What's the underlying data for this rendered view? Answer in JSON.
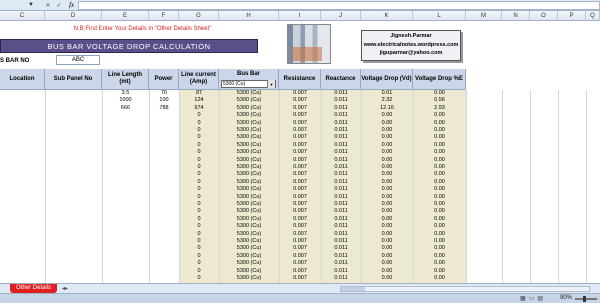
{
  "formula_bar": {
    "fx_label": "fx",
    "namebox_arrow": "▼",
    "cancel_icon": "✕",
    "enter_icon": "✓"
  },
  "columns": [
    "C",
    "D",
    "E",
    "F",
    "G",
    "H",
    "I",
    "J",
    "K",
    "L",
    "M",
    "N",
    "O",
    "P",
    "Q"
  ],
  "notice": "N.B:First Enter Your Details in \"Other Details Sheet\"",
  "title": "BUS BAR  VOLTAGE DROP  CALCULATION",
  "author": {
    "name": "Jignesh.Parmar",
    "website": "www.electricalnotes.wordpress.com",
    "email": "jiguparmar@yahoo.com"
  },
  "bus_bar_no": {
    "label": "S BAR NO",
    "value": "ABC"
  },
  "table": {
    "headers": {
      "location": "Location",
      "sub_panel": "Sub Panel No",
      "line_length": "Line Length (mt)",
      "power": "Power",
      "line_current": "Line current (Amp)",
      "bus_bar": "Bus Bar",
      "bus_bar_select": "5300 (Cu)",
      "resistance": "Resistance",
      "reactance": "Reactance",
      "vd": "Voltage Drop (Vd)",
      "vd_pct": "Voltage Drop %E"
    },
    "rows": [
      [
        "3.5",
        "70",
        "87",
        "5300 (Cu)",
        "0.007",
        "0.011",
        "0.01",
        "0.00"
      ],
      [
        "1000",
        "100",
        "124",
        "5300 (Cu)",
        "0.007",
        "0.011",
        "2.32",
        "0.56"
      ],
      [
        "666",
        "788",
        "974",
        "5300 (Cu)",
        "0.007",
        "0.011",
        "12.16",
        "2.93"
      ],
      [
        "",
        "",
        "0",
        "5300 (Cu)",
        "0.007",
        "0.011",
        "0.00",
        "0.00"
      ],
      [
        "",
        "",
        "0",
        "5300 (Cu)",
        "0.007",
        "0.011",
        "0.00",
        "0.00"
      ],
      [
        "",
        "",
        "0",
        "5300 (Cu)",
        "0.007",
        "0.011",
        "0.00",
        "0.00"
      ],
      [
        "",
        "",
        "0",
        "5300 (Cu)",
        "0.007",
        "0.011",
        "0.00",
        "0.00"
      ],
      [
        "",
        "",
        "0",
        "5300 (Cu)",
        "0.007",
        "0.011",
        "0.00",
        "0.00"
      ],
      [
        "",
        "",
        "0",
        "5300 (Cu)",
        "0.007",
        "0.011",
        "0.00",
        "0.00"
      ],
      [
        "",
        "",
        "0",
        "5300 (Cu)",
        "0.007",
        "0.011",
        "0.00",
        "0.00"
      ],
      [
        "",
        "",
        "0",
        "5300 (Cu)",
        "0.007",
        "0.011",
        "0.00",
        "0.00"
      ],
      [
        "",
        "",
        "0",
        "5300 (Cu)",
        "0.007",
        "0.011",
        "0.00",
        "0.00"
      ],
      [
        "",
        "",
        "0",
        "5300 (Cu)",
        "0.007",
        "0.011",
        "0.00",
        "0.00"
      ],
      [
        "",
        "",
        "0",
        "5300 (Cu)",
        "0.007",
        "0.011",
        "0.00",
        "0.00"
      ],
      [
        "",
        "",
        "0",
        "5300 (Cu)",
        "0.007",
        "0.011",
        "0.00",
        "0.00"
      ],
      [
        "",
        "",
        "0",
        "5300 (Cu)",
        "0.007",
        "0.011",
        "0.00",
        "0.00"
      ],
      [
        "",
        "",
        "0",
        "5300 (Cu)",
        "0.007",
        "0.011",
        "0.00",
        "0.00"
      ],
      [
        "",
        "",
        "0",
        "5300 (Cu)",
        "0.007",
        "0.011",
        "0.00",
        "0.00"
      ],
      [
        "",
        "",
        "0",
        "5300 (Cu)",
        "0.007",
        "0.011",
        "0.00",
        "0.00"
      ],
      [
        "",
        "",
        "0",
        "5300 (Cu)",
        "0.007",
        "0.011",
        "0.00",
        "0.00"
      ],
      [
        "",
        "",
        "0",
        "5300 (Cu)",
        "0.007",
        "0.011",
        "0.00",
        "0.00"
      ],
      [
        "",
        "",
        "0",
        "5300 (Cu)",
        "0.007",
        "0.011",
        "0.00",
        "0.00"
      ],
      [
        "",
        "",
        "0",
        "5300 (Cu)",
        "0.007",
        "0.011",
        "0.00",
        "0.00"
      ],
      [
        "",
        "",
        "0",
        "5300 (Cu)",
        "0.007",
        "0.011",
        "0.00",
        "0.00"
      ],
      [
        "",
        "",
        "0",
        "5300 (Cu)",
        "0.007",
        "0.011",
        "0.00",
        "0.00"
      ],
      [
        "",
        "",
        "0",
        "5300 (Cu)",
        "0.007",
        "0.011",
        "0.00",
        "0.00"
      ]
    ]
  },
  "sheet_tab": "Other Details",
  "sheet_nav_icon": "◂▸",
  "status_bar": {
    "zoom": "90%",
    "view_icons": [
      "▦",
      "▭",
      "▤"
    ]
  },
  "colors": {
    "header_fill": "#ccd6e8",
    "data_fill": "#ece9d0",
    "banner": "#5b4f8a",
    "notice": "#e02020",
    "tab": "#e02020"
  }
}
